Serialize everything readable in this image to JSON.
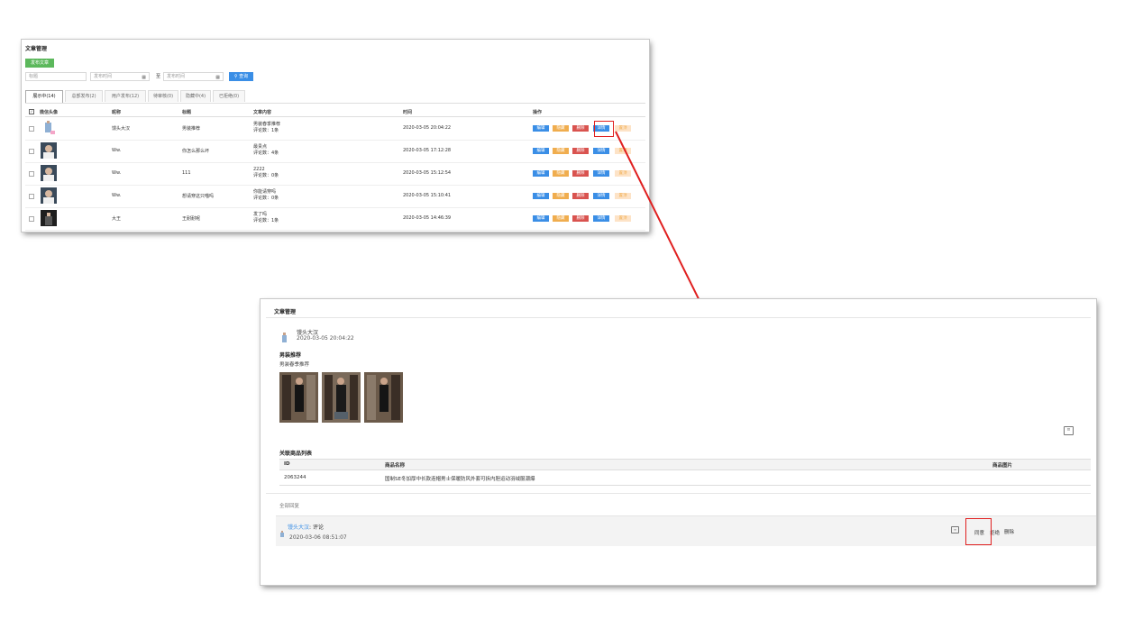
{
  "list_panel": {
    "title": "文章管理",
    "publish_button": "发布文章",
    "title_placeholder": "标题",
    "date_from_placeholder": "发布时间",
    "to_label": "至",
    "date_to_placeholder": "发布时间",
    "search_button": "查询",
    "tabs": [
      "展示中(14)",
      "总部发布(2)",
      "用户发布(12)",
      "待审核(0)",
      "隐藏中(4)",
      "已拒绝(0)"
    ],
    "columns": [
      "微信头像",
      "昵称",
      "标题",
      "文章内容",
      "时间",
      "操作"
    ],
    "rows": [
      {
        "nickname": "馒头大汉",
        "title": "男装推荐",
        "content": "男装春季推荐",
        "comments": "评论数：1条",
        "time": "2020-03-05 20:04:22"
      },
      {
        "nickname": "Ww.",
        "title": "你怎么那么坏",
        "content": "最贵点",
        "comments": "评论数：4条",
        "time": "2020-03-05 17:12:28"
      },
      {
        "nickname": "Ww.",
        "title": "111",
        "content": "2222",
        "comments": "评论数：0条",
        "time": "2020-03-05 15:12:54"
      },
      {
        "nickname": "Ww.",
        "title": "想请穿这只喵吗",
        "content": "你能请穿吗",
        "comments": "评论数：0条",
        "time": "2020-03-05 15:10:41"
      },
      {
        "nickname": "大王",
        "title": "王耐耐呢",
        "content": "发了吗",
        "comments": "评论数：1条",
        "time": "2020-03-05 14:46:39"
      }
    ],
    "ops": {
      "edit": "编辑",
      "hide": "隐藏",
      "delete": "删除",
      "detail": "详情",
      "top": "置顶"
    }
  },
  "detail_panel": {
    "title": "文章管理",
    "author": "馒头大汉",
    "post_time": "2020-03-05 20:04:22",
    "article_title": "男装推荐",
    "article_body": "男装春季推荐",
    "goods_heading": "关联商品列表",
    "goods_columns": [
      "ID",
      "商品名称",
      "商品图片"
    ],
    "goods_rows": [
      {
        "id": "2063244",
        "name": "国制SE冬加厚中长款连帽男士保暖防风外套可拆内胆运动羽绒服潮爆"
      }
    ],
    "replies_heading": "全部回复",
    "reply": {
      "user": "馒头大汉",
      "suffix": ": 评论",
      "time": "2020-03-06 08:51:07"
    },
    "reply_ops": {
      "approve": "同意",
      "reject": "拒绝",
      "delete": "删除"
    }
  },
  "colors": {
    "arrow": "#e02020",
    "green": "#5cb85c",
    "blue": "#3a8ee6",
    "orange": "#f0ad4e",
    "red": "#d9534f"
  }
}
